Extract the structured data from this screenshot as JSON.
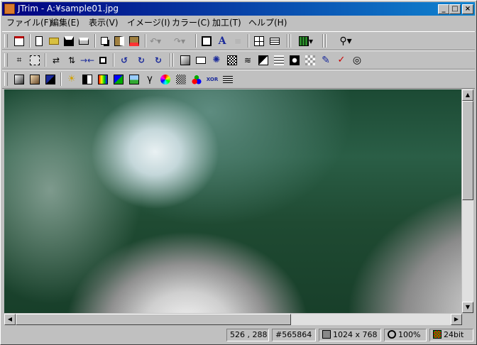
{
  "window": {
    "title": "JTrim - A:¥sample01.jpg"
  },
  "title_buttons": {
    "minimize": "_",
    "maximize": "□",
    "close": "×"
  },
  "menu": [
    "ファイル(F)",
    "編集(E)",
    "表示(V)",
    "イメージ(I)",
    "カラー(C)",
    "加工(T)",
    "ヘルプ(H)"
  ],
  "toolbar1": [
    "open-recent-icon",
    "new-icon",
    "open-icon",
    "save-icon",
    "print-icon",
    "copy-icon",
    "paste-icon",
    "paste-new-icon",
    "undo-icon",
    "redo-icon",
    "fit-window-icon",
    "text-icon",
    "disabled-icon",
    "tile-icon",
    "grid-icon",
    "view-select-icon",
    "zoom-icon"
  ],
  "toolbar2": [
    "crop-icon",
    "resize-icon",
    "flip-horizontal-icon",
    "flip-vertical-icon",
    "shrink-icon",
    "rotate-frame-icon",
    "rotate-left-90-icon",
    "rotate-right-90-icon",
    "rotate-free-icon",
    "frame-icon",
    "border-icon",
    "burst-icon",
    "mosaic-icon",
    "wave-icon",
    "emboss-icon",
    "blinds-icon",
    "spot-icon",
    "tiles-icon",
    "pen-icon",
    "redeye-icon",
    "spiral-icon"
  ],
  "toolbar3": [
    "grayscale-icon",
    "sepia-icon",
    "invert-icon",
    "brightness-icon",
    "contrast-icon",
    "color-balance-icon",
    "rgb-icon",
    "image-icon",
    "gamma-icon",
    "color-wheel-icon",
    "dither-icon",
    "rgb-dots-icon",
    "xor-icon",
    "scanline-icon"
  ],
  "toolbar3_labels": {
    "gamma": "γ",
    "xor": "XOR"
  },
  "scroll": {
    "up": "▲",
    "down": "▼",
    "left": "◀",
    "right": "▶"
  },
  "status": {
    "coords": "526 , 288",
    "color": "#565864",
    "size": "1024 x 768",
    "zoom": "100%",
    "depth": "24bit"
  }
}
